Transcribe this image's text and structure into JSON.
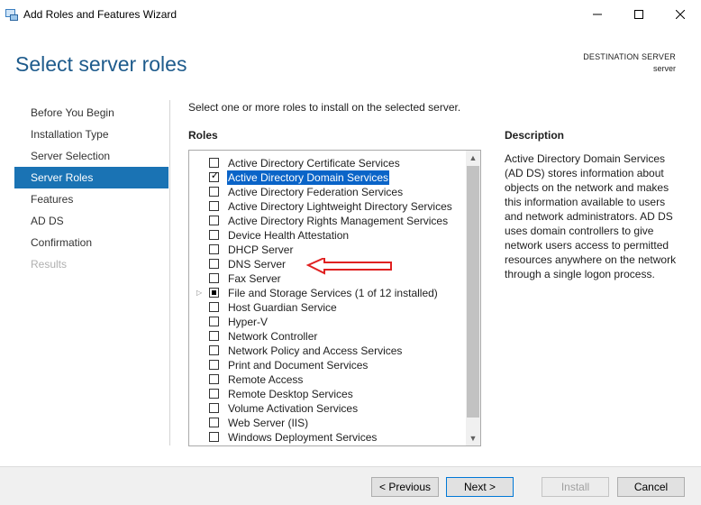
{
  "window": {
    "title": "Add Roles and Features Wizard",
    "icon": "server-manager-icon"
  },
  "page": {
    "heading": "Select server roles",
    "destination_label": "DESTINATION SERVER",
    "destination_value": "server"
  },
  "nav": {
    "items": [
      {
        "label": "Before You Begin",
        "state": "normal"
      },
      {
        "label": "Installation Type",
        "state": "normal"
      },
      {
        "label": "Server Selection",
        "state": "normal"
      },
      {
        "label": "Server Roles",
        "state": "active"
      },
      {
        "label": "Features",
        "state": "normal"
      },
      {
        "label": "AD DS",
        "state": "normal"
      },
      {
        "label": "Confirmation",
        "state": "normal"
      },
      {
        "label": "Results",
        "state": "disabled"
      }
    ]
  },
  "roles": {
    "intro": "Select one or more roles to install on the selected server.",
    "header": "Roles",
    "items": [
      {
        "label": "Active Directory Certificate Services",
        "checked": "false"
      },
      {
        "label": "Active Directory Domain Services",
        "checked": "true",
        "selected": true
      },
      {
        "label": "Active Directory Federation Services",
        "checked": "false"
      },
      {
        "label": "Active Directory Lightweight Directory Services",
        "checked": "false"
      },
      {
        "label": "Active Directory Rights Management Services",
        "checked": "false"
      },
      {
        "label": "Device Health Attestation",
        "checked": "false"
      },
      {
        "label": "DHCP Server",
        "checked": "false"
      },
      {
        "label": "DNS Server",
        "checked": "false"
      },
      {
        "label": "Fax Server",
        "checked": "false"
      },
      {
        "label": "File and Storage Services (1 of 12 installed)",
        "checked": "partial",
        "expandable": true
      },
      {
        "label": "Host Guardian Service",
        "checked": "false"
      },
      {
        "label": "Hyper-V",
        "checked": "false"
      },
      {
        "label": "Network Controller",
        "checked": "false"
      },
      {
        "label": "Network Policy and Access Services",
        "checked": "false"
      },
      {
        "label": "Print and Document Services",
        "checked": "false"
      },
      {
        "label": "Remote Access",
        "checked": "false"
      },
      {
        "label": "Remote Desktop Services",
        "checked": "false"
      },
      {
        "label": "Volume Activation Services",
        "checked": "false"
      },
      {
        "label": "Web Server (IIS)",
        "checked": "false"
      },
      {
        "label": "Windows Deployment Services",
        "checked": "false"
      }
    ]
  },
  "description": {
    "header": "Description",
    "text": "Active Directory Domain Services (AD DS) stores information about objects on the network and makes this information available to users and network administrators. AD DS uses domain controllers to give network users access to permitted resources anywhere on the network through a single logon process."
  },
  "buttons": {
    "previous": "< Previous",
    "next": "Next >",
    "install": "Install",
    "cancel": "Cancel"
  },
  "annotation": {
    "arrow_color": "#e02020",
    "points_to": "DNS Server"
  },
  "colors": {
    "heading": "#1e5b8c",
    "nav_active": "#1a73b4",
    "selection": "#0a64c8"
  }
}
